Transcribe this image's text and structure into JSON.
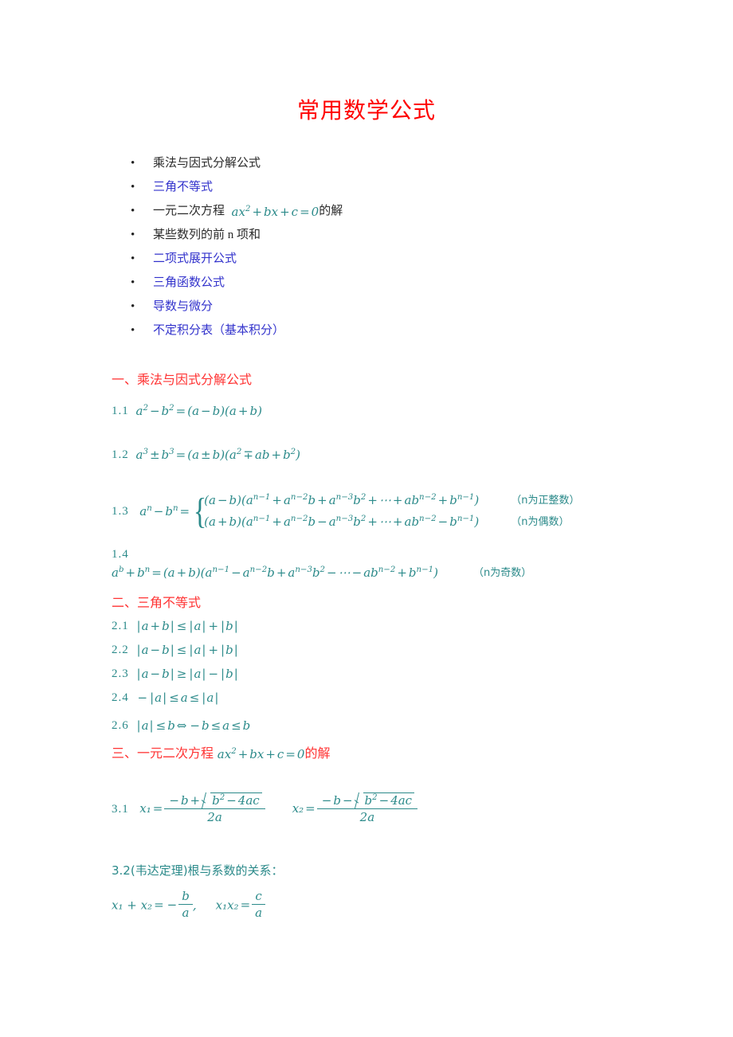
{
  "document": {
    "title": "常用数学公式",
    "title_color": "#ff0000",
    "link_color": "#3333cc",
    "formula_color": "#2b8a8a",
    "heading_color": "#ff3333",
    "body_color": "#2b2b2b"
  },
  "toc": {
    "bullet_glyph": "•",
    "items": [
      {
        "label": "乘法与因式分解公式",
        "style": "plain",
        "has_formula": false
      },
      {
        "label": "三角不等式",
        "style": "link",
        "has_formula": false
      },
      {
        "label_before": "一元二次方程",
        "formula": "ax² + bx + c = 0",
        "label_after": "的解",
        "style": "plain",
        "has_formula": true
      },
      {
        "label": "某些数列的前 n 项和",
        "style": "plain",
        "has_formula": false
      },
      {
        "label": "二项式展开公式",
        "style": "link",
        "has_formula": false
      },
      {
        "label": "三角函数公式",
        "style": "link",
        "has_formula": false
      },
      {
        "label": "导数与微分",
        "style": "link",
        "has_formula": false
      },
      {
        "label": "不定积分表（基本积分）",
        "style": "link",
        "has_formula": false
      }
    ]
  },
  "sections": {
    "s1": {
      "heading": "一、乘法与因式分解公式",
      "items": {
        "n11": "1.1",
        "n12": "1.2",
        "n13": "1.3",
        "n14": "1.4"
      },
      "formulas": {
        "f11": "a² − b² = (a − b)(a + b)",
        "f12": "a³ ± b³ = (a ± b)(a² ∓ ab + b²)",
        "f13_lhs": "aⁿ − bⁿ =",
        "f13_case1": "(a − b)(aⁿ⁻¹ + aⁿ⁻²b + aⁿ⁻³b² + ⋯ + abⁿ⁻² + bⁿ⁻¹)",
        "f13_case1_note": "（n为正整数）",
        "f13_case2": "(a + b)(aⁿ⁻¹ + aⁿ⁻²b − aⁿ⁻³b² + ⋯ + abⁿ⁻² − bⁿ⁻¹)",
        "f13_case2_note": "（n为偶数）",
        "f14": "a^b + bⁿ = (a + b)(aⁿ⁻¹ − aⁿ⁻²b + aⁿ⁻³b² − ⋯ − abⁿ⁻² + bⁿ⁻¹)",
        "f14_note": "（n为奇数）"
      }
    },
    "s2": {
      "heading": "二、三角不等式",
      "items": {
        "n21": "2.1",
        "n22": "2.2",
        "n23": "2.3",
        "n24": "2.4",
        "n26": "2.6"
      },
      "formulas": {
        "f21": "|a + b| ≤ |a| + |b|",
        "f22": "|a − b| ≤ |a| + |b|",
        "f23": "|a − b| ≥ |a| − |b|",
        "f24": "− |a| ≤ a ≤ |a|",
        "f26": "|a| ≤ b ⇔ − b ≤ a ≤ b"
      }
    },
    "s3": {
      "heading_before": "三、一元二次方程",
      "heading_formula": "ax² + bx + c = 0",
      "heading_after": "的解",
      "items": {
        "n31": "3.1"
      },
      "formulas": {
        "f31_x1": "x₁ = (−b + √(b² − 4ac)) / 2a",
        "f31_x2": "x₂ = (−b − √(b² − 4ac)) / 2a",
        "x1_label": "x₁",
        "x2_label": "x₂",
        "numer_sign_1": "+",
        "numer_sign_2": "−",
        "radicand": "b² − 4ac",
        "denominator": "2a"
      },
      "vieta": {
        "heading": "3.2(韦达定理)根与系数的关系：",
        "formula": "x₁ + x₂ = − b/a,  x₁x₂ = c/a",
        "sum_lhs": "x₁ + x₂",
        "sum_rhs_num": "b",
        "sum_rhs_den": "a",
        "prod_lhs": "x₁x₂",
        "prod_rhs_num": "c",
        "prod_rhs_den": "a"
      }
    }
  }
}
